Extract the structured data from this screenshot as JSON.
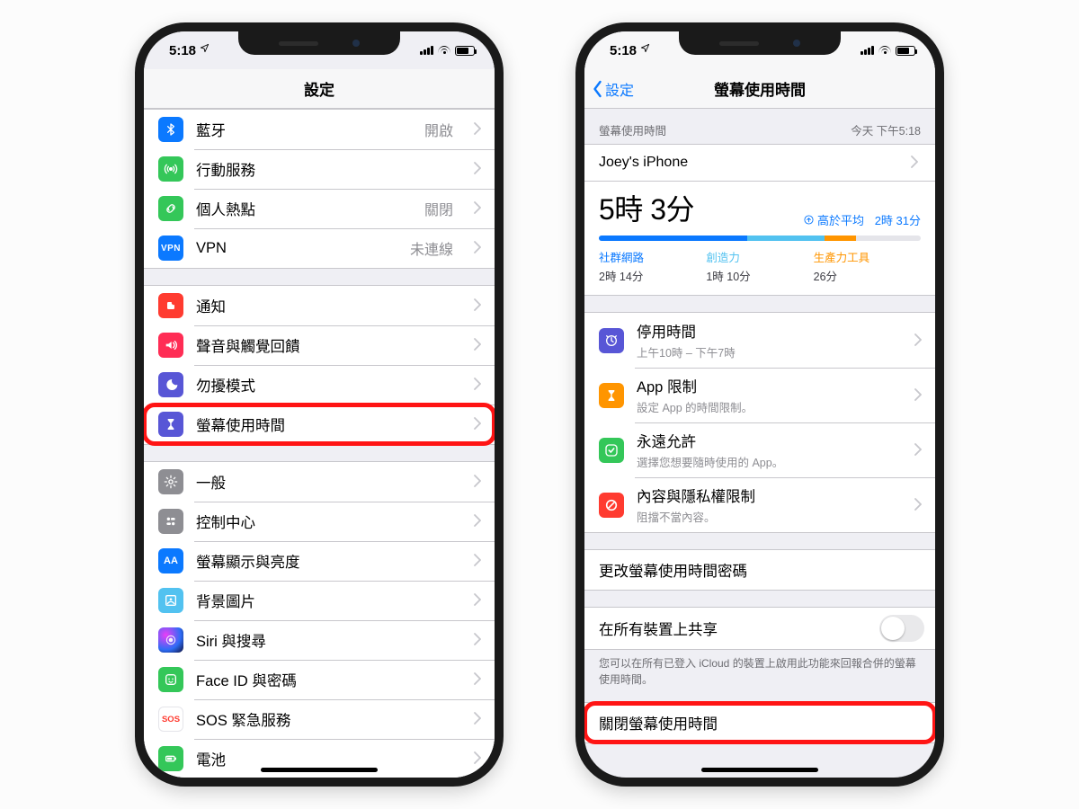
{
  "status": {
    "time": "5:18",
    "location_icon": "◤"
  },
  "left": {
    "title": "設定",
    "group1": [
      {
        "icon": "ic-bt",
        "name": "bluetooth",
        "glyph": "bt",
        "label": "藍牙",
        "value": "開啟"
      },
      {
        "icon": "ic-cell",
        "name": "cellular",
        "glyph": "cell",
        "label": "行動服務",
        "value": ""
      },
      {
        "icon": "ic-hot",
        "name": "hotspot",
        "glyph": "link",
        "label": "個人熱點",
        "value": "關閉"
      },
      {
        "icon": "ic-vpn",
        "name": "vpn",
        "glyph": "text",
        "text": "VPN",
        "label": "VPN",
        "value": "未連線"
      }
    ],
    "group2": [
      {
        "icon": "ic-notif",
        "name": "notifications",
        "glyph": "notif",
        "label": "通知"
      },
      {
        "icon": "ic-snd",
        "name": "sounds",
        "glyph": "sound",
        "label": "聲音與觸覺回饋"
      },
      {
        "icon": "ic-dnd",
        "name": "dnd",
        "glyph": "moon",
        "label": "勿擾模式"
      },
      {
        "icon": "ic-st",
        "name": "screentime",
        "glyph": "hour",
        "label": "螢幕使用時間",
        "highlight": true
      }
    ],
    "group3": [
      {
        "icon": "ic-gen",
        "name": "general",
        "glyph": "gear",
        "label": "一般"
      },
      {
        "icon": "ic-cc",
        "name": "control-center",
        "glyph": "cc",
        "label": "控制中心"
      },
      {
        "icon": "ic-disp",
        "name": "display",
        "glyph": "text",
        "text": "AA",
        "label": "螢幕顯示與亮度"
      },
      {
        "icon": "ic-wall",
        "name": "wallpaper",
        "glyph": "wall",
        "label": "背景圖片"
      },
      {
        "icon": "ic-siri",
        "name": "siri",
        "glyph": "siri",
        "label": "Siri 與搜尋"
      },
      {
        "icon": "ic-face",
        "name": "faceid",
        "glyph": "face",
        "label": "Face ID 與密碼"
      },
      {
        "icon": "ic-sos",
        "name": "sos",
        "glyph": "text",
        "text": "SOS",
        "label": "SOS 緊急服務"
      },
      {
        "icon": "ic-batt",
        "name": "battery",
        "glyph": "batt",
        "label": "電池"
      }
    ]
  },
  "right": {
    "back": "設定",
    "title": "螢幕使用時間",
    "summary": {
      "section_label": "螢幕使用時間",
      "timestamp": "今天 下午5:18",
      "device": "Joey's iPhone",
      "total": "5時 3分",
      "avg_prefix": "高於平均",
      "avg_value": "2時 31分",
      "bar": {
        "b1": 46,
        "b2": 24,
        "b3": 10
      },
      "cats": [
        {
          "name": "社群網路",
          "time": "2時 14分"
        },
        {
          "name": "創造力",
          "time": "1時 10分"
        },
        {
          "name": "生產力工具",
          "time": "26分"
        }
      ]
    },
    "controls": [
      {
        "icon": "ic-down",
        "name": "downtime",
        "glyph": "moon2",
        "label": "停用時間",
        "sub": "上午10時 – 下午7時"
      },
      {
        "icon": "ic-limit",
        "name": "applimits",
        "glyph": "hour",
        "label": "App 限制",
        "sub": "設定 App 的時間限制。"
      },
      {
        "icon": "ic-allow",
        "name": "alwaysallow",
        "glyph": "check",
        "label": "永遠允許",
        "sub": "選擇您想要隨時使用的 App。"
      },
      {
        "icon": "ic-restr",
        "name": "restrict",
        "glyph": "no",
        "label": "內容與隱私權限制",
        "sub": "阻擋不當內容。"
      }
    ],
    "passcode_link": "更改螢幕使用時間密碼",
    "share": {
      "label": "在所有裝置上共享"
    },
    "share_footer": "您可以在所有已登入 iCloud 的裝置上啟用此功能來回報合併的螢幕使用時間。",
    "turn_off": "關閉螢幕使用時間"
  }
}
